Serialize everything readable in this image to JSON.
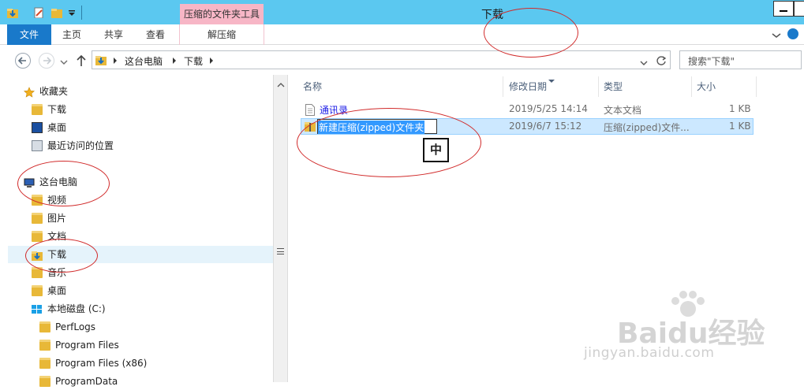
{
  "window": {
    "title": "下载"
  },
  "ribbon": {
    "context_header": "压缩的文件夹工具",
    "tabs": [
      {
        "label": "文件"
      },
      {
        "label": "主页"
      },
      {
        "label": "共享"
      },
      {
        "label": "查看"
      },
      {
        "label": "解压缩"
      }
    ]
  },
  "address": {
    "crumbs": [
      "这台电脑",
      "下载"
    ],
    "search_placeholder": "搜索\"下载\""
  },
  "navpane": {
    "favorites_label": "收藏夹",
    "favorites": [
      {
        "label": "下载",
        "icon": "downloads-folder-icon"
      },
      {
        "label": "桌面",
        "icon": "desktop-icon"
      },
      {
        "label": "最近访问的位置",
        "icon": "recent-places-icon"
      }
    ],
    "pc_label": "这台电脑",
    "pc_items": [
      {
        "label": "视频",
        "icon": "videos-folder-icon"
      },
      {
        "label": "图片",
        "icon": "pictures-folder-icon"
      },
      {
        "label": "文档",
        "icon": "documents-folder-icon"
      },
      {
        "label": "下载",
        "icon": "downloads-folder-icon",
        "selected": true
      },
      {
        "label": "音乐",
        "icon": "music-folder-icon"
      },
      {
        "label": "桌面",
        "icon": "desktop-folder-icon"
      }
    ],
    "drive_label": "本地磁盘 (C:)",
    "drive_items": [
      {
        "label": "PerfLogs"
      },
      {
        "label": "Program Files"
      },
      {
        "label": "Program Files (x86)"
      },
      {
        "label": "ProgramData"
      }
    ]
  },
  "columns": {
    "name": "名称",
    "date": "修改日期",
    "type": "类型",
    "size": "大小"
  },
  "files": [
    {
      "name": "通讯录",
      "date": "2019/5/25 14:14",
      "type": "文本文档",
      "size": "1 KB"
    },
    {
      "name": "新建压缩(zipped)文件夹",
      "date": "2019/6/7 15:12",
      "type": "压缩(zipped)文件...",
      "size": "1 KB",
      "renaming": true
    }
  ],
  "ime_indicator": "中",
  "watermark": {
    "brand": "Baidu经验",
    "url": "jingyan.baidu.com"
  },
  "colors": {
    "titlebar": "#5bc8f0",
    "file_tab": "#1979ca",
    "context_tab": "#f7b6c6",
    "annotation": "#d12b2b",
    "selection": "#cce8ff"
  }
}
